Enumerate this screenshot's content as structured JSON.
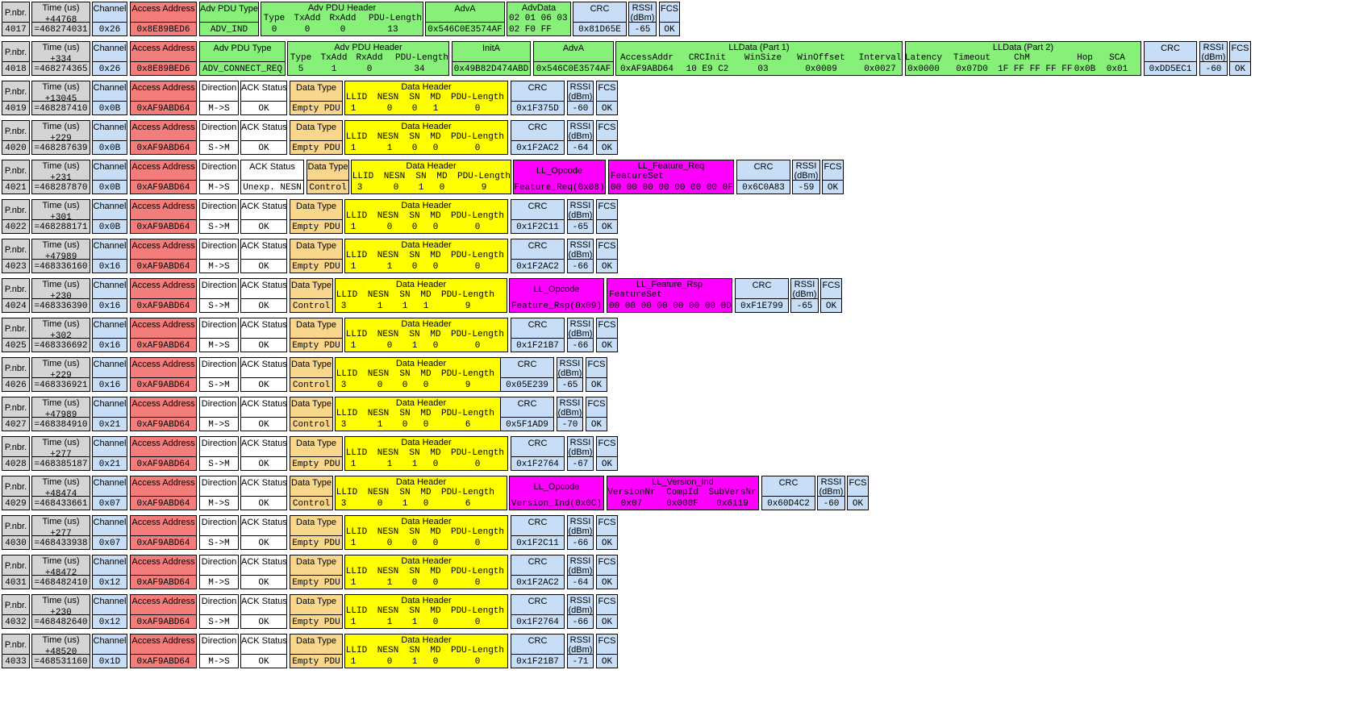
{
  "colors": {
    "gray": "#d4d4d4",
    "blue": "#c7def6",
    "red": "#f27d7a",
    "green": "#86f079",
    "white": "#ffffff",
    "orange": "#f8d68b",
    "yellow": "#ffff00",
    "magenta": "#ff00ff"
  },
  "headers": {
    "pnbr": "P.nbr.",
    "time": "Time (us)",
    "channel": "Channel",
    "access_address": "Access Address",
    "adv_pdu_type": "Adv PDU Type",
    "adv_pdu_header": "Adv PDU Header",
    "adva": "AdvA",
    "advdata": "AdvData",
    "inita": "InitA",
    "lldata1": "LLData (Part 1)",
    "lldata2": "LLData (Part 2)",
    "crc": "CRC",
    "rssi1": "RSSI",
    "rssi2": "(dBm)",
    "fcs": "FCS",
    "direction": "Direction",
    "ack_status": "ACK Status",
    "data_type": "Data Type",
    "data_header": "Data Header",
    "ll_opcode": "LL_Opcode",
    "ll_feature_req": "LL_Feature_Req",
    "ll_feature_rsp": "LL_Feature_Rsp",
    "ll_version_ind": "LL_Version_Ind",
    "featureset": "FeatureSet"
  },
  "packets": [
    {
      "pnbr": "4017",
      "delta": "+44768",
      "time": "=468274031",
      "channel": "0x26",
      "aa": "0x8E89BED6",
      "adv_type": "ADV_IND",
      "adv_header": {
        "labels": [
          "Type",
          "TxAdd",
          "RxAdd",
          "PDU-Length"
        ],
        "values": [
          "0",
          "0",
          "0",
          "13"
        ]
      },
      "adva": "0x546C0E3574AF",
      "advdata1": "02 01 06 03",
      "advdata2": "02 F0 FF",
      "crc": "0x81D65E",
      "rssi": "-65",
      "fcs": "OK"
    },
    {
      "pnbr": "4018",
      "delta": "+334",
      "time": "=468274365",
      "channel": "0x26",
      "aa": "0x8E89BED6",
      "adv_type": "ADV_CONNECT_REQ",
      "adv_header": {
        "labels": [
          "Type",
          "TxAdd",
          "RxAdd",
          "PDU-Length"
        ],
        "values": [
          "5",
          "1",
          "0",
          "34"
        ]
      },
      "inita": "0x49B82D474ABD",
      "adva": "0x546C0E3574AF",
      "lldata1": {
        "labels": [
          "AccessAddr",
          "CRCInit",
          "WinSize",
          "WinOffset",
          "Interval"
        ],
        "values": [
          "0xAF9ABD64",
          "10 E9 C2",
          "03",
          "0x0009",
          "0x0027"
        ]
      },
      "lldata2": {
        "labels": [
          "Latency",
          "Timeout",
          "ChM",
          "Hop",
          "SCA"
        ],
        "values": [
          "0x0000",
          "0x07D0",
          "1F FF FF FF FF",
          "0x0B",
          "0x01"
        ]
      },
      "crc": "0xDD5EC1",
      "rssi": "-60",
      "fcs": "OK"
    },
    {
      "pnbr": "4019",
      "delta": "+13045",
      "time": "=468287410",
      "channel": "0x0B",
      "aa": "0xAF9ABD64",
      "dir": "M->S",
      "ack": "OK",
      "dtype": "Empty PDU",
      "llid": "1",
      "nesn": "0",
      "sn": "0",
      "md": "1",
      "len": "0",
      "crc": "0x1F375D",
      "rssi": "-60",
      "fcs": "OK"
    },
    {
      "pnbr": "4020",
      "delta": "+229",
      "time": "=468287639",
      "channel": "0x0B",
      "aa": "0xAF9ABD64",
      "dir": "S->M",
      "ack": "OK",
      "dtype": "Empty PDU",
      "llid": "1",
      "nesn": "1",
      "sn": "0",
      "md": "0",
      "len": "0",
      "crc": "0x1F2AC2",
      "rssi": "-64",
      "fcs": "OK"
    },
    {
      "pnbr": "4021",
      "delta": "+231",
      "time": "=468287870",
      "channel": "0x0B",
      "aa": "0xAF9ABD64",
      "dir": "M->S",
      "ack": "Unexp. NESN",
      "dtype": "Control",
      "llid": "3",
      "nesn": "0",
      "sn": "1",
      "md": "0",
      "len": "9",
      "opcode": "Feature_Req(0x08)",
      "ll_title": "LL_Feature_Req",
      "ll_label": "FeatureSet",
      "ll_value": "00 00 00 00 00 00 00 0F",
      "crc": "0x6C0A83",
      "rssi": "-59",
      "fcs": "OK"
    },
    {
      "pnbr": "4022",
      "delta": "+301",
      "time": "=468288171",
      "channel": "0x0B",
      "aa": "0xAF9ABD64",
      "dir": "S->M",
      "ack": "OK",
      "dtype": "Empty PDU",
      "llid": "1",
      "nesn": "0",
      "sn": "0",
      "md": "0",
      "len": "0",
      "crc": "0x1F2C11",
      "rssi": "-65",
      "fcs": "OK"
    },
    {
      "pnbr": "4023",
      "delta": "+47989",
      "time": "=468336160",
      "channel": "0x16",
      "aa": "0xAF9ABD64",
      "dir": "M->S",
      "ack": "OK",
      "dtype": "Empty PDU",
      "llid": "1",
      "nesn": "1",
      "sn": "0",
      "md": "0",
      "len": "0",
      "crc": "0x1F2AC2",
      "rssi": "-66",
      "fcs": "OK"
    },
    {
      "pnbr": "4024",
      "delta": "+230",
      "time": "=468336390",
      "channel": "0x16",
      "aa": "0xAF9ABD64",
      "dir": "S->M",
      "ack": "OK",
      "dtype": "Control",
      "llid": "3",
      "nesn": "1",
      "sn": "1",
      "md": "1",
      "len": "9",
      "opcode": "Feature_Rsp(0x09)",
      "ll_title": "LL_Feature_Rsp",
      "ll_label": "FeatureSet",
      "ll_value": "00 00 00 00 00 00 00 0D",
      "crc": "0xF1E799",
      "rssi": "-65",
      "fcs": "OK"
    },
    {
      "pnbr": "4025",
      "delta": "+302",
      "time": "=468336692",
      "channel": "0x16",
      "aa": "0xAF9ABD64",
      "dir": "M->S",
      "ack": "OK",
      "dtype": "Empty PDU",
      "llid": "1",
      "nesn": "0",
      "sn": "1",
      "md": "0",
      "len": "0",
      "crc": "0x1F21B7",
      "rssi": "-66",
      "fcs": "OK"
    },
    {
      "pnbr": "4026",
      "delta": "+229",
      "time": "=468336921",
      "channel": "0x16",
      "aa": "0xAF9ABD64",
      "dir": "S->M",
      "ack": "OK",
      "dtype": "Control",
      "llid": "3",
      "nesn": "0",
      "sn": "0",
      "md": "0",
      "len": "9",
      "crc": "0x05E239",
      "rssi": "-65",
      "fcs": "OK"
    },
    {
      "pnbr": "4027",
      "delta": "+47989",
      "time": "=468384910",
      "channel": "0x21",
      "aa": "0xAF9ABD64",
      "dir": "M->S",
      "ack": "OK",
      "dtype": "Control",
      "llid": "3",
      "nesn": "1",
      "sn": "0",
      "md": "0",
      "len": "6",
      "crc": "0x5F1AD9",
      "rssi": "-70",
      "fcs": "OK"
    },
    {
      "pnbr": "4028",
      "delta": "+277",
      "time": "=468385187",
      "channel": "0x21",
      "aa": "0xAF9ABD64",
      "dir": "S->M",
      "ack": "OK",
      "dtype": "Empty PDU",
      "llid": "1",
      "nesn": "1",
      "sn": "1",
      "md": "0",
      "len": "0",
      "crc": "0x1F2764",
      "rssi": "-67",
      "fcs": "OK"
    },
    {
      "pnbr": "4029",
      "delta": "+48474",
      "time": "=468433661",
      "channel": "0x07",
      "aa": "0xAF9ABD64",
      "dir": "M->S",
      "ack": "OK",
      "dtype": "Control",
      "llid": "3",
      "nesn": "0",
      "sn": "1",
      "md": "0",
      "len": "6",
      "opcode": "Version_Ind(0x0C)",
      "ll_title": "LL_Version_Ind",
      "version": {
        "labels": [
          "VersionNr",
          "CompId",
          "SubVersNr"
        ],
        "values": [
          "0x07",
          "0x000F",
          "0x6119"
        ]
      },
      "crc": "0x60D4C2",
      "rssi": "-60",
      "fcs": "OK"
    },
    {
      "pnbr": "4030",
      "delta": "+277",
      "time": "=468433938",
      "channel": "0x07",
      "aa": "0xAF9ABD64",
      "dir": "S->M",
      "ack": "OK",
      "dtype": "Empty PDU",
      "llid": "1",
      "nesn": "0",
      "sn": "0",
      "md": "0",
      "len": "0",
      "crc": "0x1F2C11",
      "rssi": "-66",
      "fcs": "OK"
    },
    {
      "pnbr": "4031",
      "delta": "+48472",
      "time": "=468482410",
      "channel": "0x12",
      "aa": "0xAF9ABD64",
      "dir": "M->S",
      "ack": "OK",
      "dtype": "Empty PDU",
      "llid": "1",
      "nesn": "1",
      "sn": "0",
      "md": "0",
      "len": "0",
      "crc": "0x1F2AC2",
      "rssi": "-64",
      "fcs": "OK"
    },
    {
      "pnbr": "4032",
      "delta": "+230",
      "time": "=468482640",
      "channel": "0x12",
      "aa": "0xAF9ABD64",
      "dir": "S->M",
      "ack": "OK",
      "dtype": "Empty PDU",
      "llid": "1",
      "nesn": "1",
      "sn": "1",
      "md": "0",
      "len": "0",
      "crc": "0x1F2764",
      "rssi": "-66",
      "fcs": "OK"
    },
    {
      "pnbr": "4033",
      "delta": "+48520",
      "time": "=468531160",
      "channel": "0x1D",
      "aa": "0xAF9ABD64",
      "dir": "M->S",
      "ack": "OK",
      "dtype": "Empty PDU",
      "llid": "1",
      "nesn": "0",
      "sn": "1",
      "md": "0",
      "len": "0",
      "crc": "0x1F21B7",
      "rssi": "-71",
      "fcs": "OK"
    }
  ]
}
